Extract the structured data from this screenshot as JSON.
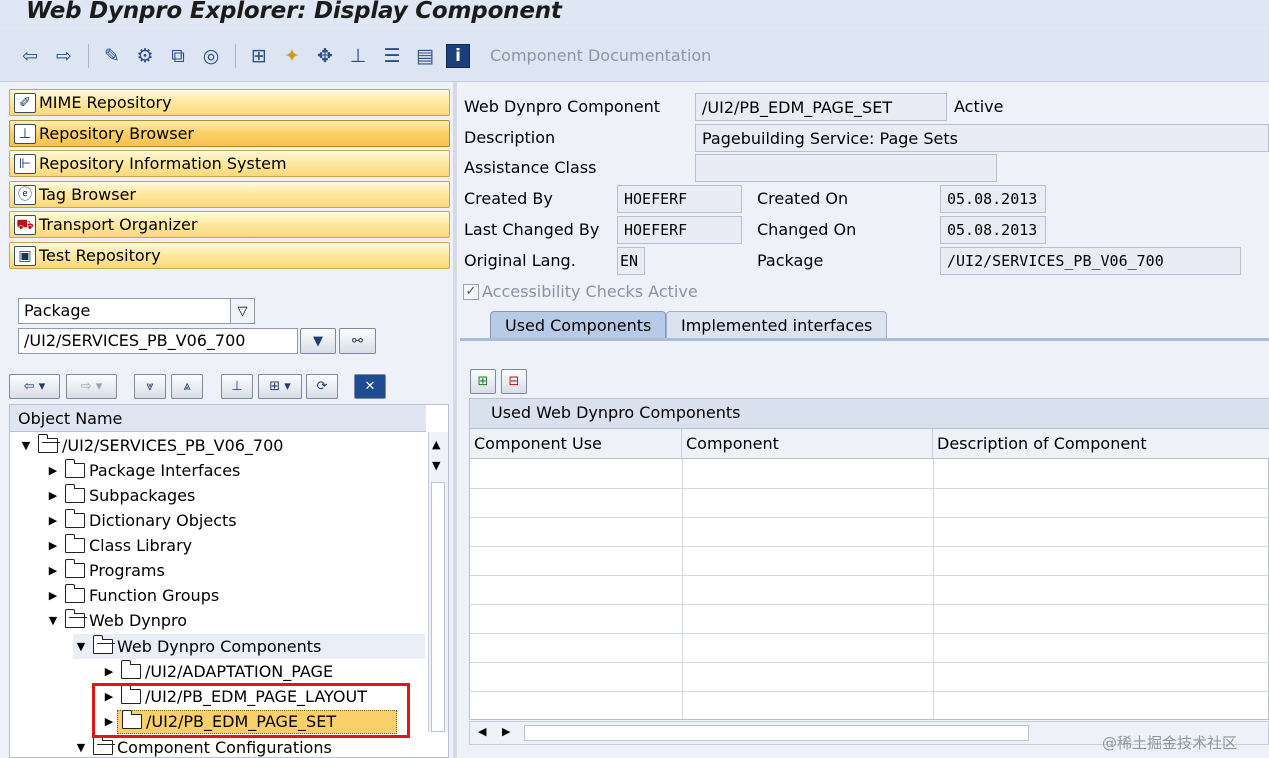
{
  "window": {
    "title": "Web Dynpro Explorer: Display Component"
  },
  "toolbar": {
    "component_documentation": "Component Documentation",
    "icons": [
      "back-arrow-icon",
      "forward-arrow-icon",
      "edit-icon",
      "toggle-active-icon",
      "where-used-icon",
      "display-object-list-icon",
      "navigation-window-icon",
      "activate-icon",
      "move-icon",
      "hierarchy-icon",
      "stack-icon",
      "list-icon",
      "info-icon"
    ]
  },
  "sidebar": {
    "nav": [
      {
        "label": "MIME Repository",
        "icon": "mime-icon"
      },
      {
        "label": "Repository Browser",
        "icon": "repository-browser-icon"
      },
      {
        "label": "Repository Information System",
        "icon": "info-system-icon"
      },
      {
        "label": "Tag Browser",
        "icon": "tag-browser-icon"
      },
      {
        "label": "Transport Organizer",
        "icon": "transport-truck-icon"
      },
      {
        "label": "Test Repository",
        "icon": "test-repository-icon"
      }
    ],
    "object_type": "Package",
    "object_value": "/UI2/SERVICES_PB_V06_700"
  },
  "tree": {
    "header": "Object Name",
    "rows": [
      {
        "label": "/UI2/SERVICES_PB_V06_700",
        "expanded": true
      },
      {
        "label": "Package Interfaces",
        "expanded": false
      },
      {
        "label": "Subpackages",
        "expanded": false
      },
      {
        "label": "Dictionary Objects",
        "expanded": false
      },
      {
        "label": "Class Library",
        "expanded": false
      },
      {
        "label": "Programs",
        "expanded": false
      },
      {
        "label": "Function Groups",
        "expanded": false
      },
      {
        "label": "Web Dynpro",
        "expanded": true
      },
      {
        "label": "Web Dynpro Components",
        "expanded": true
      },
      {
        "label": "/UI2/ADAPTATION_PAGE",
        "expanded": false
      },
      {
        "label": "/UI2/PB_EDM_PAGE_LAYOUT",
        "expanded": false
      },
      {
        "label": "/UI2/PB_EDM_PAGE_SET",
        "expanded": false,
        "selected": true
      },
      {
        "label": "Component Configurations",
        "expanded": true
      }
    ]
  },
  "detail": {
    "component_label": "Web Dynpro Component",
    "component_value": "/UI2/PB_EDM_PAGE_SET",
    "status": "Active",
    "description_label": "Description",
    "description_value": "Pagebuilding Service: Page Sets",
    "assistance_label": "Assistance Class",
    "assistance_value": "",
    "created_by_label": "Created By",
    "created_by_value": "HOEFERF",
    "created_on_label": "Created On",
    "created_on_value": "05.08.2013",
    "changed_by_label": "Last Changed By",
    "changed_by_value": "HOEFERF",
    "changed_on_label": "Changed On",
    "changed_on_value": "05.08.2013",
    "lang_label": "Original Lang.",
    "lang_value": "EN",
    "package_label": "Package",
    "package_value": "/UI2/SERVICES_PB_V06_700",
    "accessibility_label": "Accessibility Checks Active"
  },
  "tabs": [
    {
      "label": "Used Components",
      "active": true
    },
    {
      "label": "Implemented interfaces",
      "active": false
    }
  ],
  "grid": {
    "title": "Used Web Dynpro Components",
    "columns": [
      "Component Use",
      "Component",
      "Description of Component"
    ],
    "rows": []
  },
  "watermark": "@稀土掘金技术社区",
  "colors": {
    "highlight_box": "#e21616",
    "nav_button": "#fbd87a"
  }
}
